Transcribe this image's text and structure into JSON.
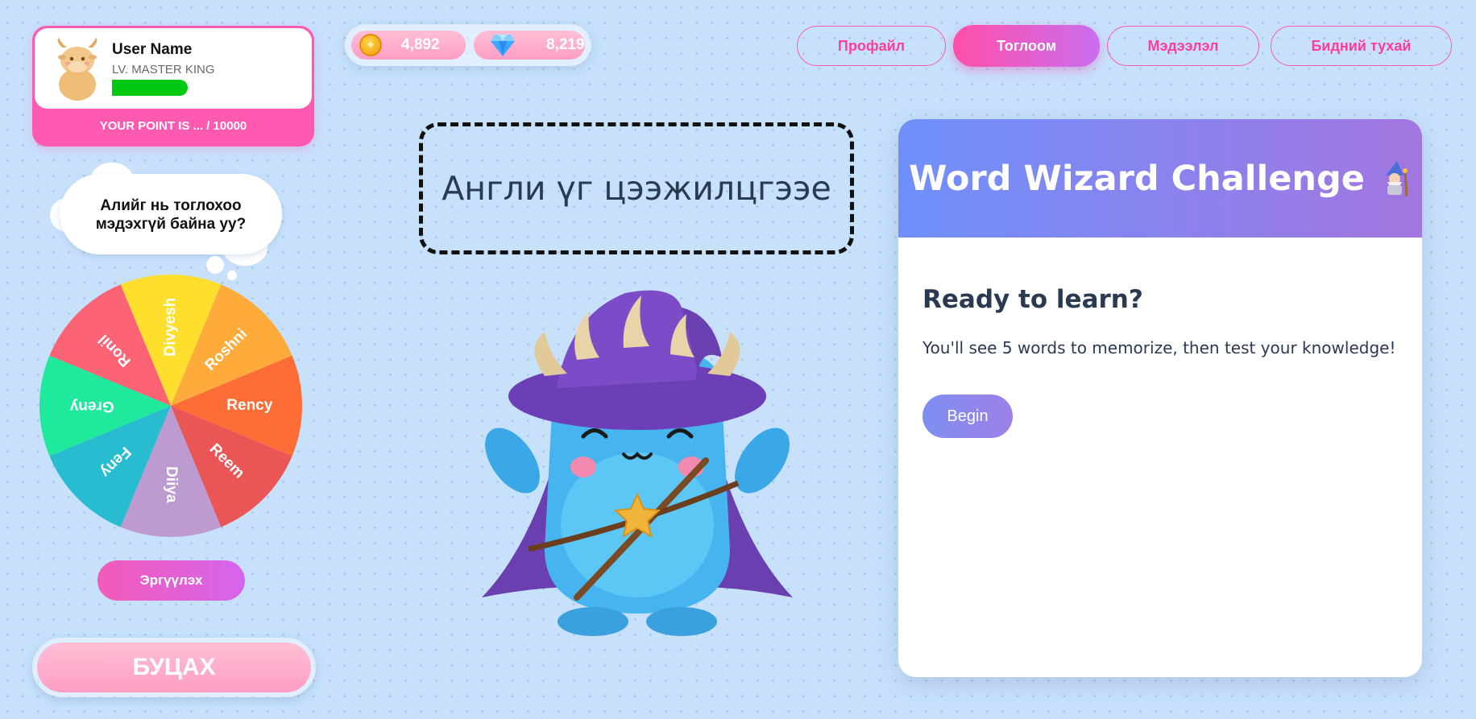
{
  "profile": {
    "name": "User Name",
    "level": "LV. MASTER KING",
    "points_text": "YOUR POINT IS ... / 10000",
    "avatar_icon": "bull-avatar-icon"
  },
  "currency": {
    "coins": "4,892",
    "gems": "8,219",
    "coin_icon": "coin-icon",
    "gem_icon": "diamond-icon"
  },
  "nav": {
    "items": [
      {
        "label": "Профайл",
        "active": false
      },
      {
        "label": "Тоглоом",
        "active": true
      },
      {
        "label": "Мэдээлэл",
        "active": false
      },
      {
        "label": "Бидний тухай",
        "active": false
      }
    ]
  },
  "thought": {
    "line1": "Алийг нь тоглохоо",
    "line2": "мэдэхгүй байна уу?"
  },
  "wheel": {
    "segments": [
      {
        "label": "Divyesh",
        "color": "#ffdf2e"
      },
      {
        "label": "Roshni",
        "color": "#ffab3c"
      },
      {
        "label": "Rency",
        "color": "#ff6d36"
      },
      {
        "label": "Reem",
        "color": "#ea5555"
      },
      {
        "label": "Diiya",
        "color": "#bd9bd1"
      },
      {
        "label": "Feny",
        "color": "#28bcd0"
      },
      {
        "label": "Greny",
        "color": "#1ee99d"
      },
      {
        "label": "Ronil",
        "color": "#fc6374"
      }
    ],
    "spin_label": "Эргүүлэх"
  },
  "back_label": "БУЦАХ",
  "main": {
    "title": "Англи үг цээжилцгээе",
    "mascot": "wizard-monster-mascot"
  },
  "challenge": {
    "title": "Word Wizard Challenge",
    "title_icon": "wizard-icon",
    "heading": "Ready to learn?",
    "description": "You'll see 5 words to memorize, then test your knowledge!",
    "button_label": "Begin"
  },
  "colors": {
    "accent_pink": "#ff5ab1",
    "level_bar": "#00c912",
    "header_gradient_start": "#6f90fb",
    "header_gradient_end": "#a276e0"
  }
}
